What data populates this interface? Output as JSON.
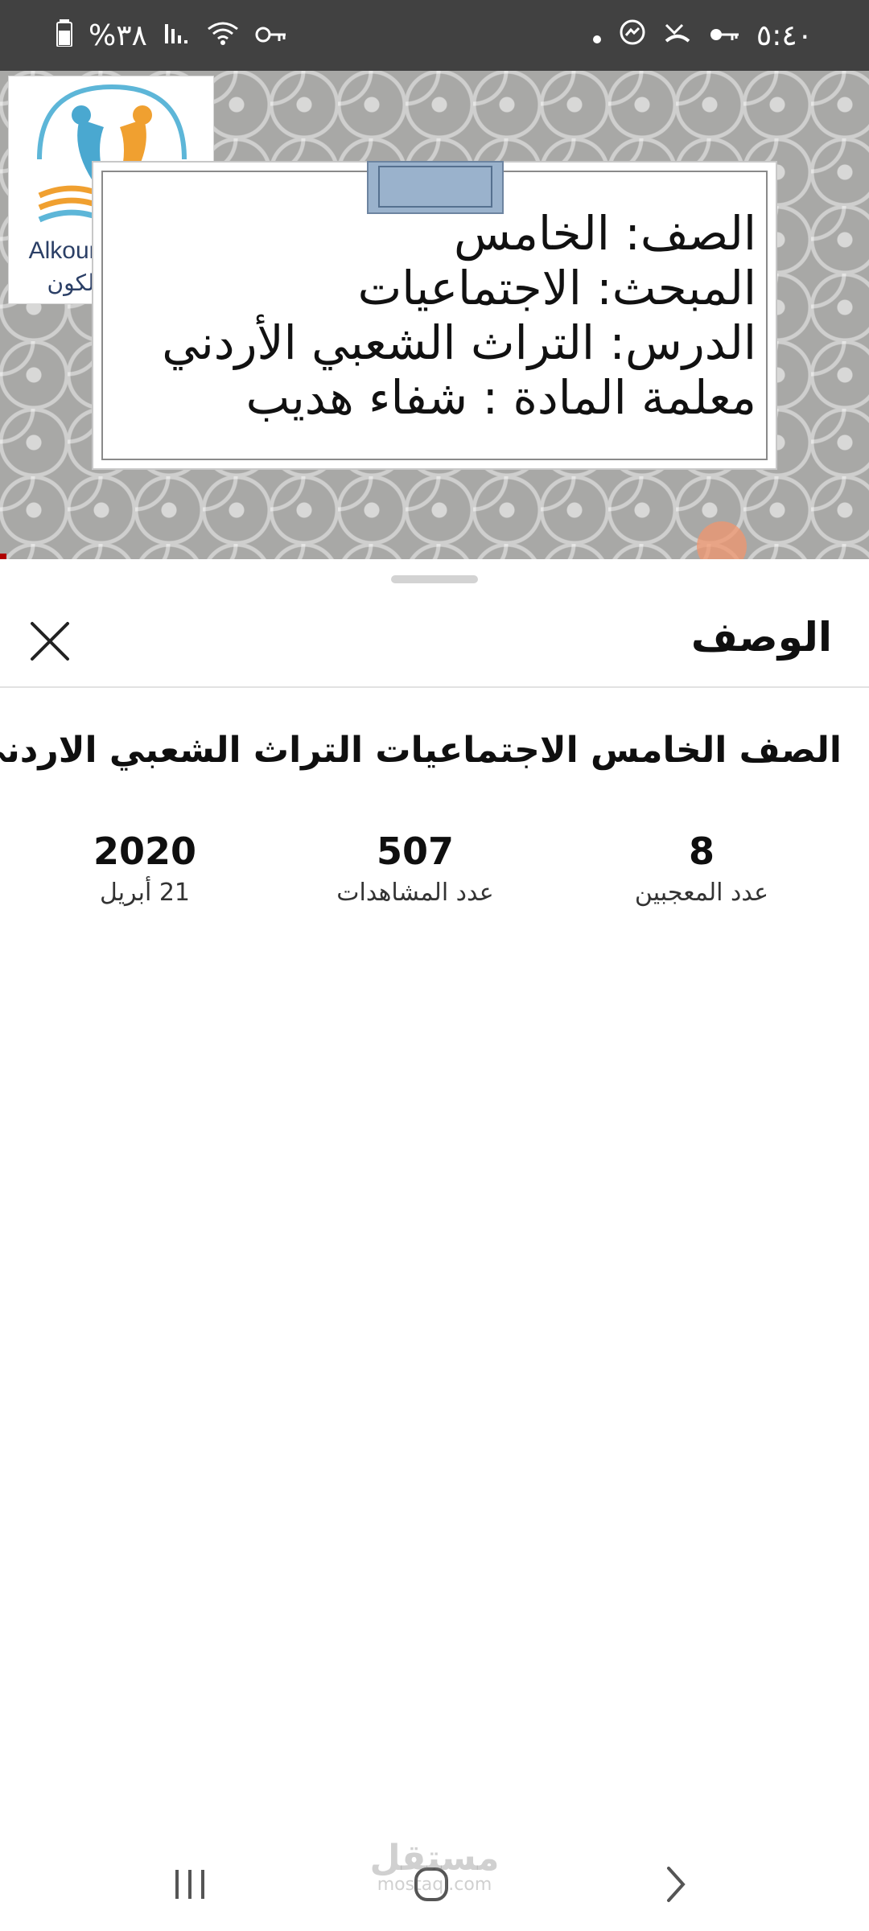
{
  "status_bar": {
    "time": "٥:٤٠",
    "battery": "%٣٨"
  },
  "video": {
    "logo_text_en": "Alkoun Schools",
    "logo_text_ar": "مدارس الكون",
    "slide_lines": [
      "الصف: الخامس",
      "المبحث: الاجتماعيات",
      "الدرس: التراث الشعبي الأردني",
      "معلمة المادة : شفاء هديب"
    ]
  },
  "sheet": {
    "title": "الوصف",
    "description_title": "الصف الخامس الاجتماعيات التراث الشعبي الاردني",
    "stats": {
      "likes": {
        "value": "8",
        "label": "عدد المعجبين"
      },
      "views": {
        "value": "507",
        "label": "عدد المشاهدات"
      },
      "date": {
        "value": "2020",
        "label": "21 أبريل"
      }
    }
  },
  "watermark": {
    "text": "مستقل",
    "sub": "mostaql.com"
  },
  "icons": {
    "close": "close-icon",
    "recents": "recents-icon",
    "home": "home-icon",
    "back": "back-icon"
  }
}
